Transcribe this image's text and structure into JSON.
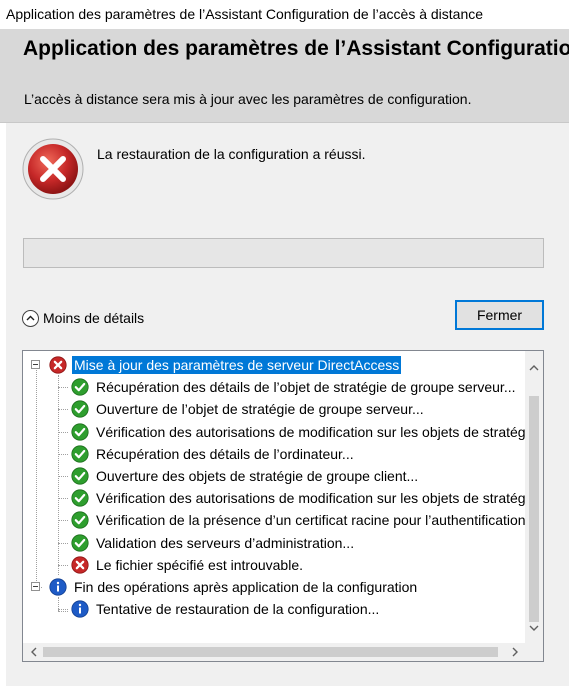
{
  "window": {
    "title": "Application des paramètres de l’Assistant Configuration de l’accès à distance"
  },
  "header": {
    "heading": "Application des paramètres de l’Assistant Configuration",
    "subheading": "L’accès à distance sera mis à jour avec les paramètres de configuration."
  },
  "status": {
    "icon": "error-icon",
    "message": "La restauration de la configuration a réussi.",
    "progress": 0
  },
  "details_toggle": {
    "label": "Moins de détails",
    "icon": "chevron-up-icon"
  },
  "close_button": {
    "label": "Fermer"
  },
  "tree": {
    "groups": [
      {
        "label": "Mise à jour des paramètres de serveur DirectAccess",
        "status": "error",
        "selected": true,
        "items": [
          {
            "label": "Récupération des détails de l’objet de stratégie de groupe serveur...",
            "status": "success"
          },
          {
            "label": "Ouverture de l’objet de stratégie de groupe serveur...",
            "status": "success"
          },
          {
            "label": "Vérification des autorisations de modification sur les objets de stratégie de g",
            "status": "success"
          },
          {
            "label": "Récupération des détails de l’ordinateur...",
            "status": "success"
          },
          {
            "label": "Ouverture des objets de stratégie de groupe client...",
            "status": "success"
          },
          {
            "label": "Vérification des autorisations de modification sur les objets de stratégie de g",
            "status": "success"
          },
          {
            "label": "Vérification de la présence d’un certificat racine pour l’authentification IPsec",
            "status": "success"
          },
          {
            "label": "Validation des serveurs d’administration...",
            "status": "success"
          },
          {
            "label": "Le fichier spécifié est introuvable.",
            "status": "error"
          }
        ]
      },
      {
        "label": "Fin des opérations après application de la configuration",
        "status": "info",
        "selected": false,
        "items": [
          {
            "label": "Tentative de restauration de la configuration...",
            "status": "info"
          }
        ]
      }
    ]
  },
  "colors": {
    "accent": "#0078d7",
    "success": "#2e9e2e",
    "error": "#c62828",
    "info": "#1e5bc6",
    "header_bg": "#d8d8d8"
  }
}
